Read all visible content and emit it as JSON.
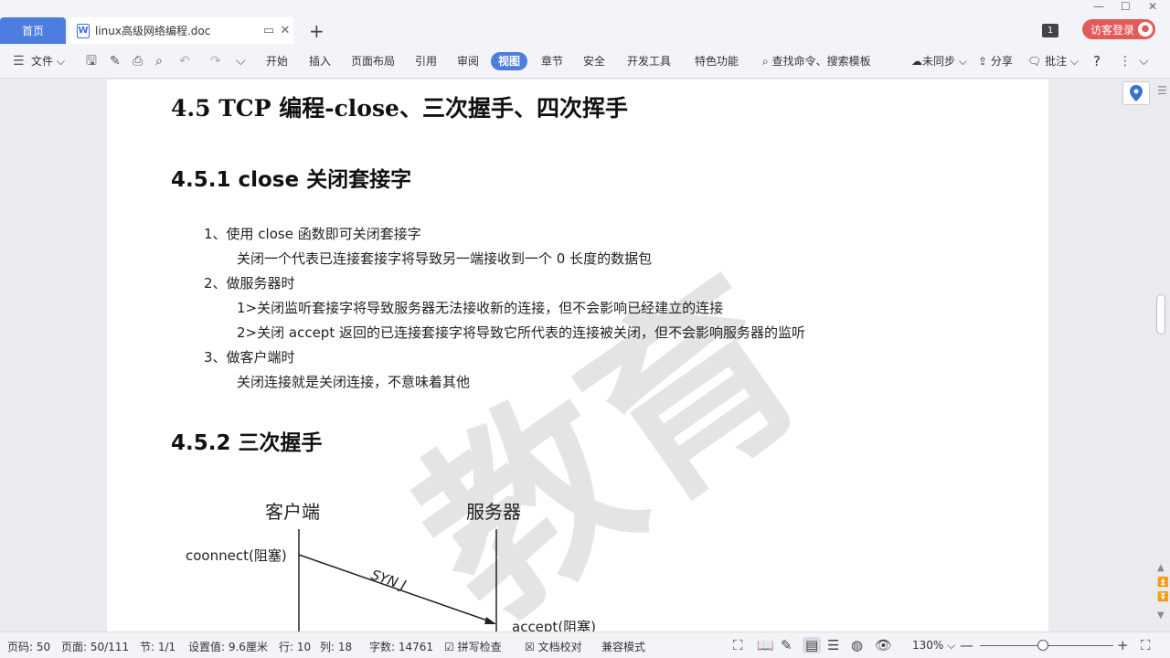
{
  "tabs": {
    "home": "首页",
    "doc": "linux高级网络编程.doc",
    "new_tab_icon": "plus-icon"
  },
  "window": {
    "badge": "1",
    "login": "访客登录"
  },
  "ribbon": {
    "file": "文件",
    "menus": [
      "开始",
      "插入",
      "页面布局",
      "引用",
      "审阅",
      "视图",
      "章节",
      "安全",
      "开发工具",
      "特色功能"
    ],
    "active_menu": "视图",
    "search": "查找命令、搜索模板",
    "sync": "未同步",
    "share": "分享",
    "comment": "批注",
    "help": "?"
  },
  "document": {
    "title": "4.5 TCP 编程-close、三次握手、四次挥手",
    "section1_title": "4.5.1 close  关闭套接字",
    "lines": [
      "1、使用 close 函数即可关闭套接字",
      "关闭一个代表已连接套接字将导致另一端接收到一个 0 长度的数据包",
      "2、做服务器时",
      "1>关闭监听套接字将导致服务器无法接收新的连接，但不会影响已经建立的连接",
      "2>关闭 accept 返回的已连接套接字将导致它所代表的连接被关闭，但不会影响服务器的监听",
      "3、做客户端时",
      "关闭连接就是关闭连接，不意味着其他"
    ],
    "section2_title": "4.5.2 三次握手",
    "diagram": {
      "client": "客户端",
      "server": "服务器",
      "connect": "coonnect(阻塞)",
      "syn": "SYN J",
      "accept": "accept(阻塞)"
    }
  },
  "status": {
    "page_no": "页码: 50",
    "pages": "页面: 50/111",
    "section": "节: 1/1",
    "setting": "设置值: 9.6厘米",
    "row": "行: 10",
    "col": "列: 18",
    "words": "字数: 14761",
    "spell": "拼写检查",
    "proof": "文档校对",
    "compat": "兼容模式",
    "zoom": "130%",
    "zoom_level": 0.47
  },
  "colors": {
    "accent": "#4d7de0",
    "login": "#e25b5b"
  }
}
